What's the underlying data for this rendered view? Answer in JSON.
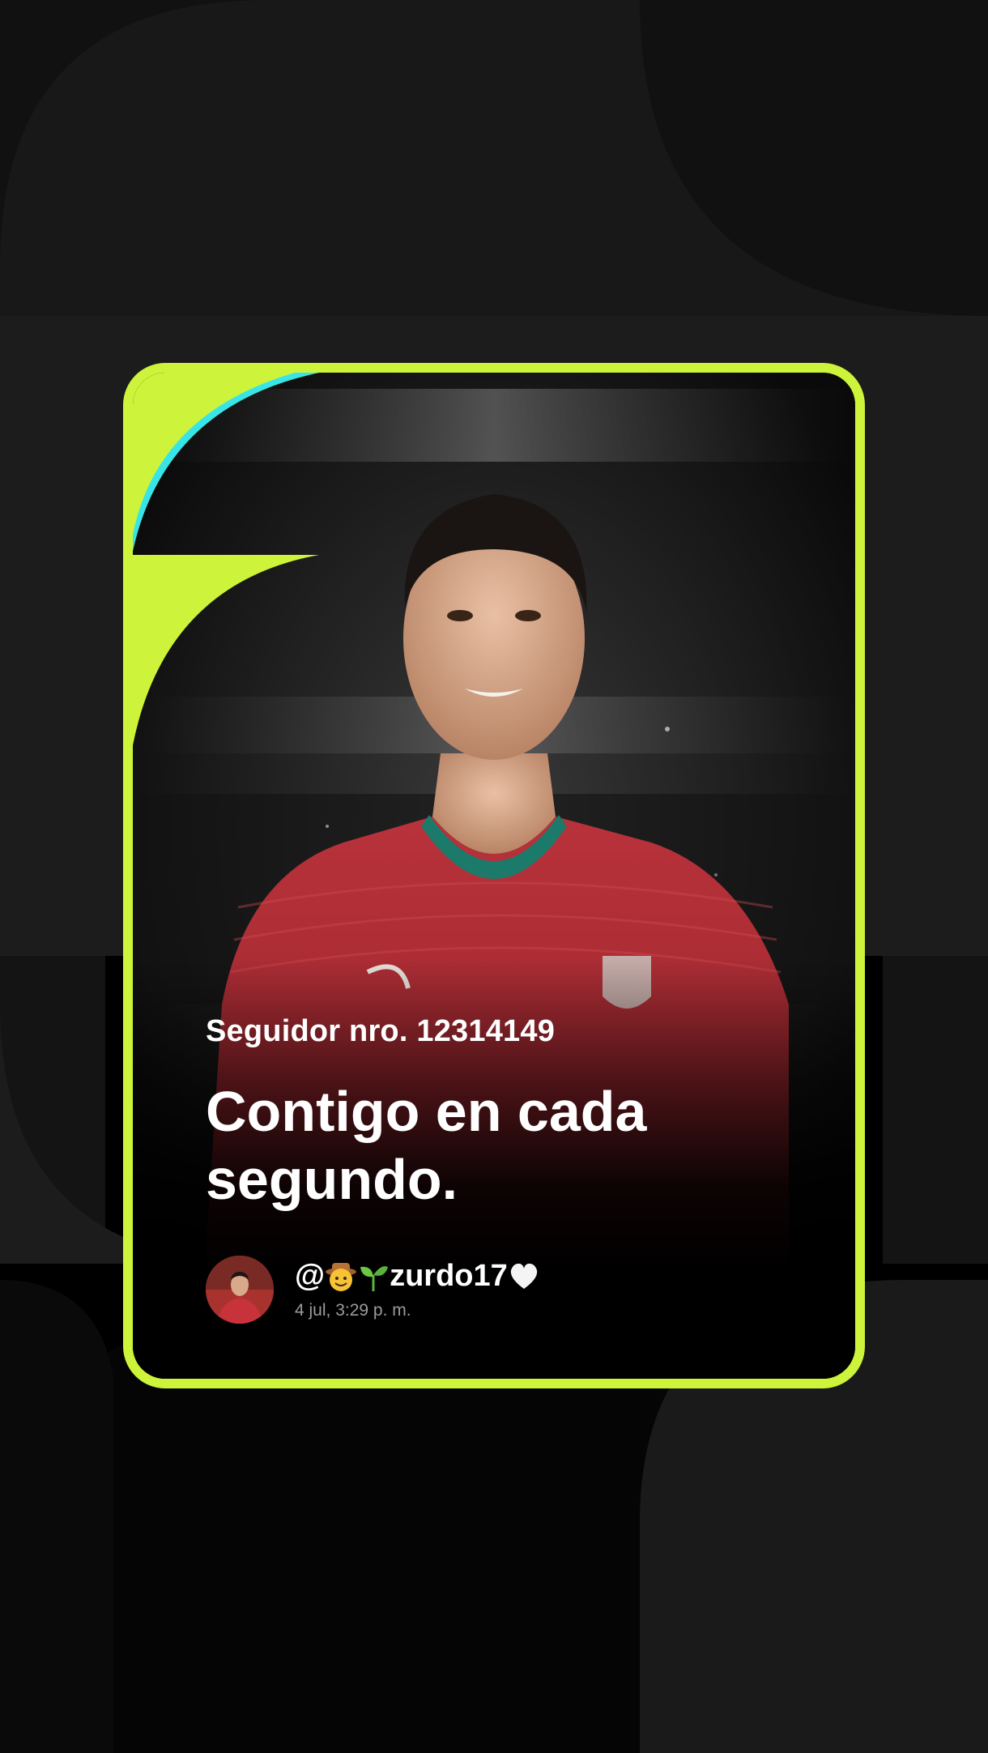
{
  "card": {
    "follower_label": "Seguidor nro. 12314149",
    "headline": "Contigo en cada segundo.",
    "user": {
      "at": "@",
      "emoji_1": "cowboy-face-emoji",
      "emoji_2": "seedling-emoji",
      "name": "zurdo17",
      "emoji_3": "white-heart-emoji"
    },
    "timestamp": "4 jul, 3:29 p. m."
  },
  "colors": {
    "accent": "#cdf43a",
    "accent_secondary": "#37e5e9",
    "background": "#000000",
    "deco": "#1a1a1a"
  }
}
